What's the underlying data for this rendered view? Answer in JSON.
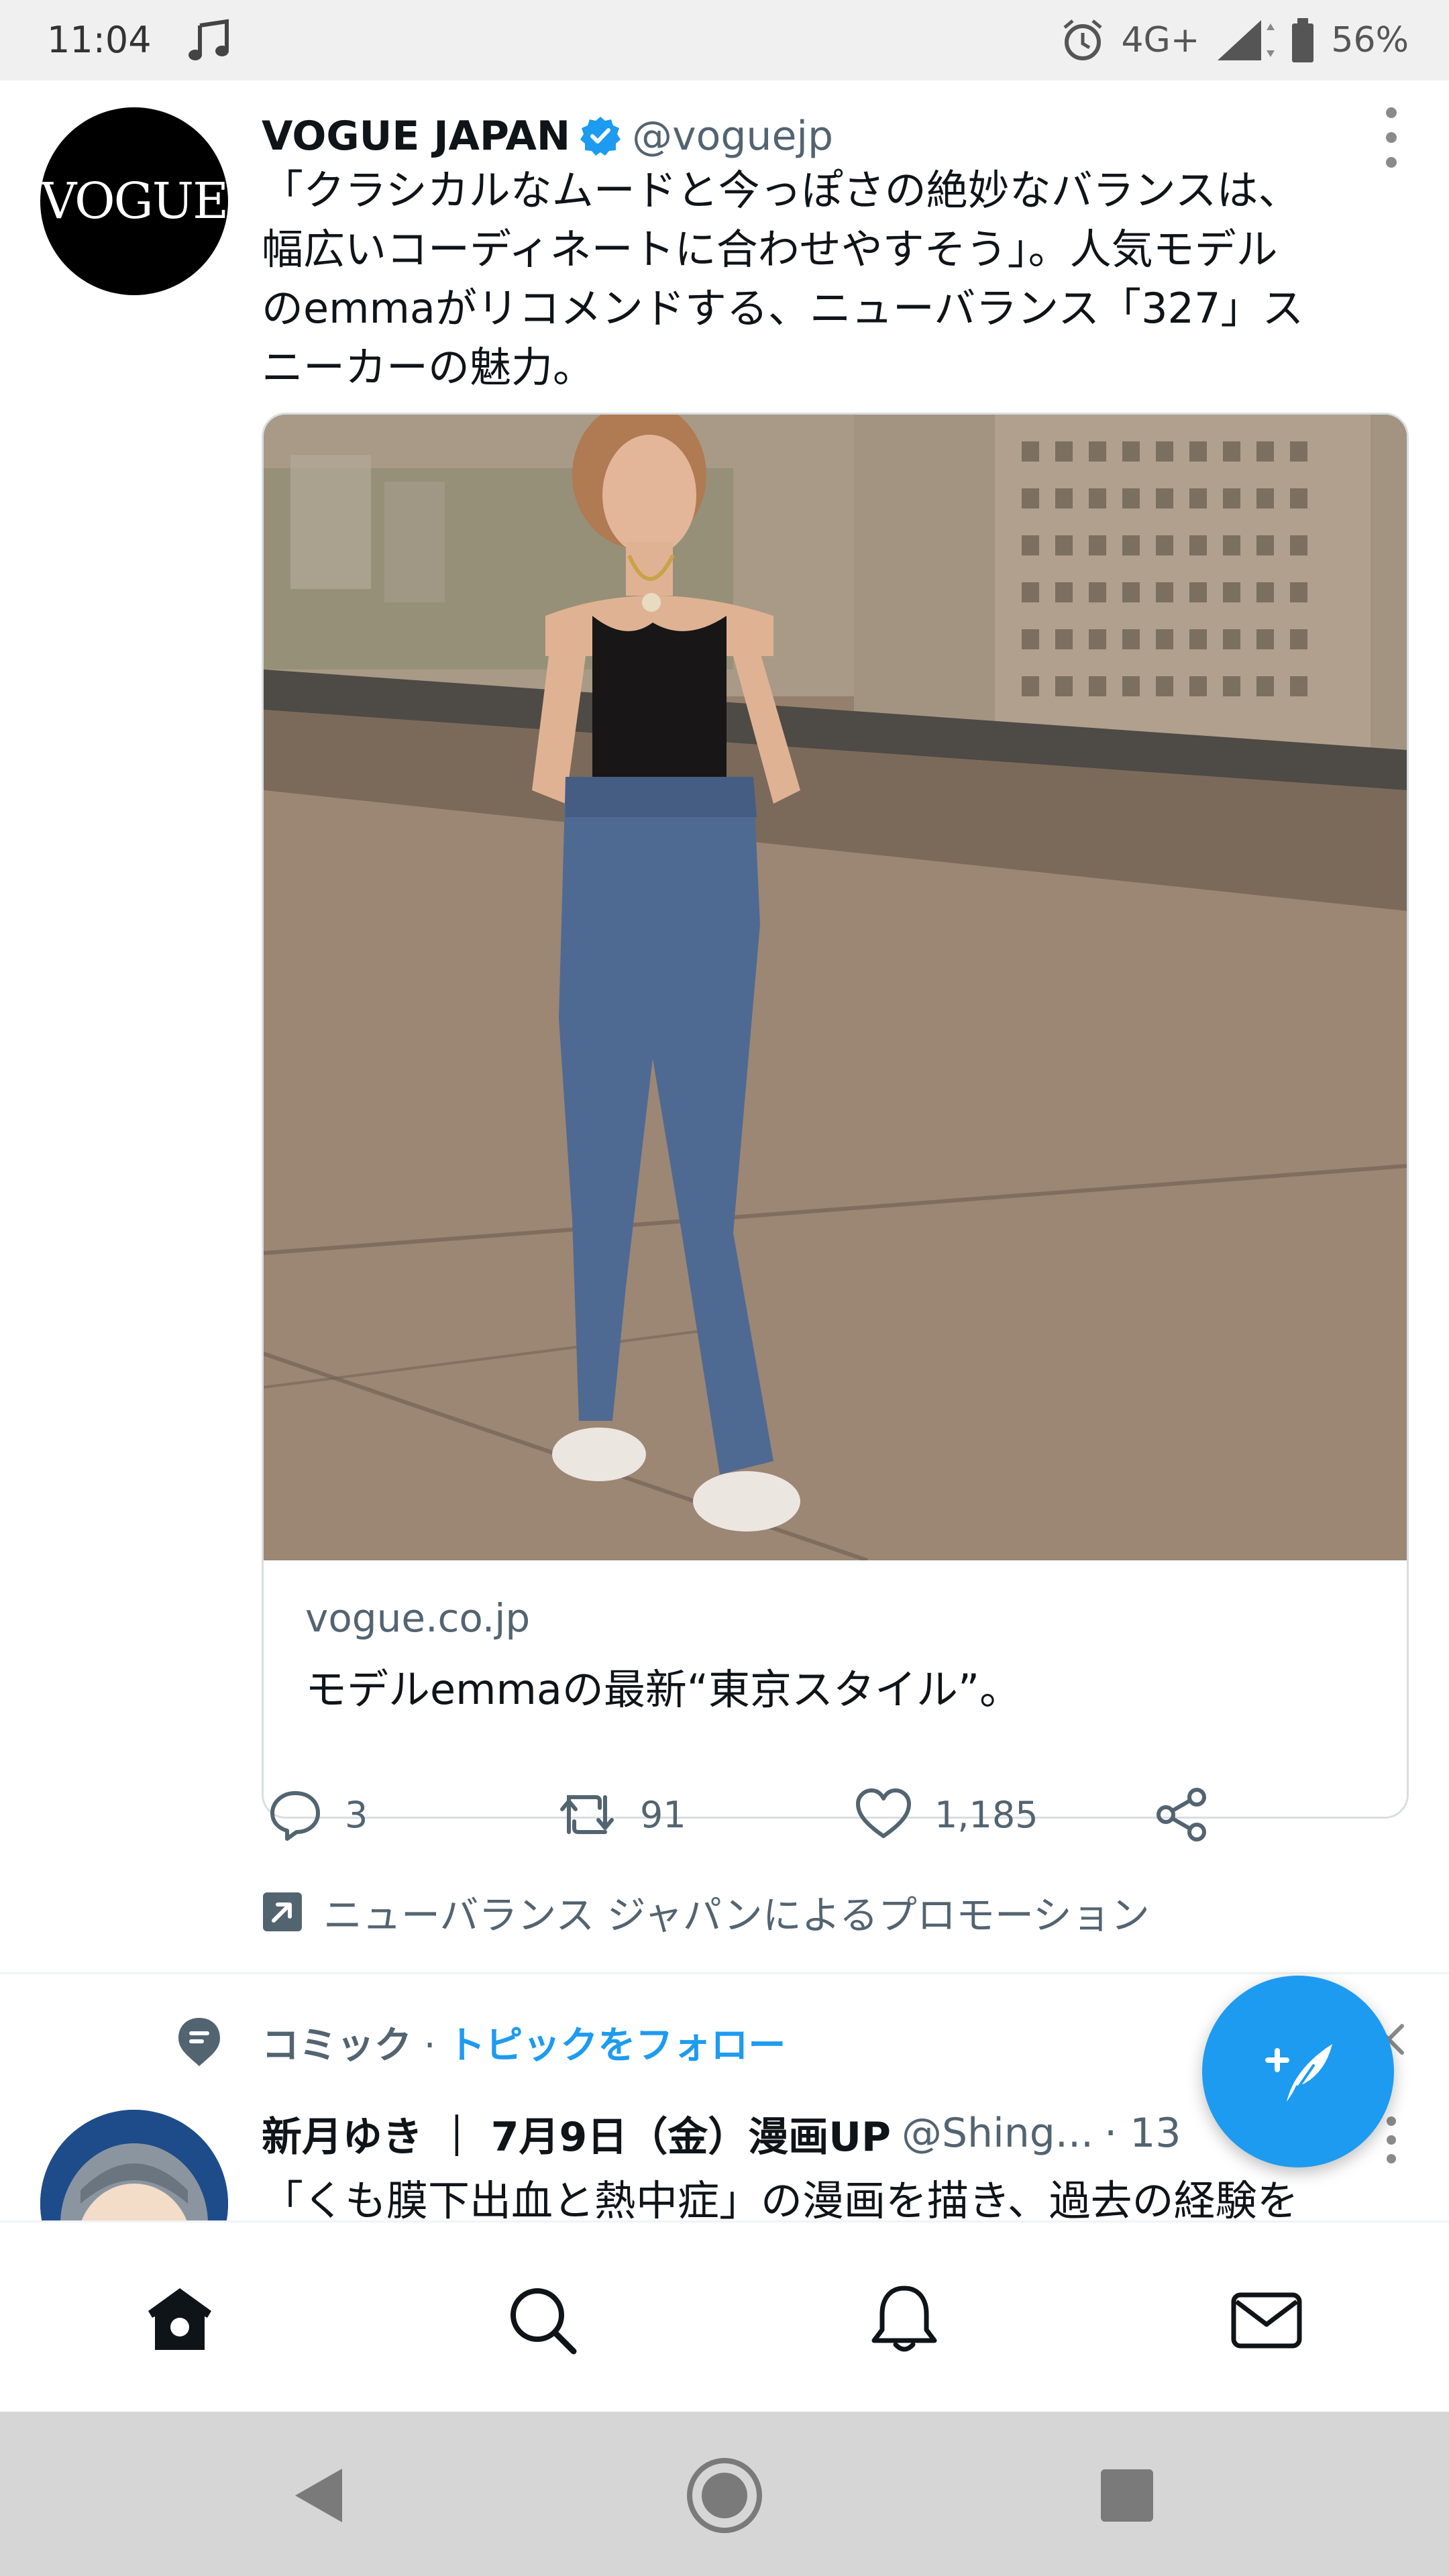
{
  "status_bar": {
    "time": "11:04",
    "network": "4G+",
    "battery": "56%",
    "icons": [
      "music-note-icon",
      "alarm-icon",
      "signal-icon",
      "battery-icon"
    ]
  },
  "tweet1": {
    "author_name": "VOGUE JAPAN",
    "author_handle": "@voguejp",
    "avatar_text": "VOGUE",
    "text_lines": [
      "「クラシカルなムードと今っぽさの絶妙なバランスは、",
      "幅広いコーディネートに合わせやすそう」。人気モデル",
      "のemmaがリコメンドする、ニューバランス「327」ス",
      "ニーカーの魅力。"
    ],
    "card": {
      "domain": "vogue.co.jp",
      "title": "モデルemmaの最新“東京スタイル”。"
    },
    "actions": {
      "replies": "3",
      "retweets": "91",
      "likes": "1,185"
    },
    "promoted_text": "ニューバランス ジャパンによるプロモーション"
  },
  "topic": {
    "label": "コミック",
    "separator": " · ",
    "follow": "トピックをフォロー"
  },
  "tweet2": {
    "author_name": "新月ゆき ｜ 7月9日（金）漫画UP",
    "author_handle": "@Shing...",
    "time": "· 13",
    "text": "「くも膜下出血と熱中症」の漫画を描き、過去の経験を"
  },
  "colors": {
    "accent": "#1d9bf0",
    "text_primary": "#0f1419",
    "text_secondary": "#536471"
  }
}
